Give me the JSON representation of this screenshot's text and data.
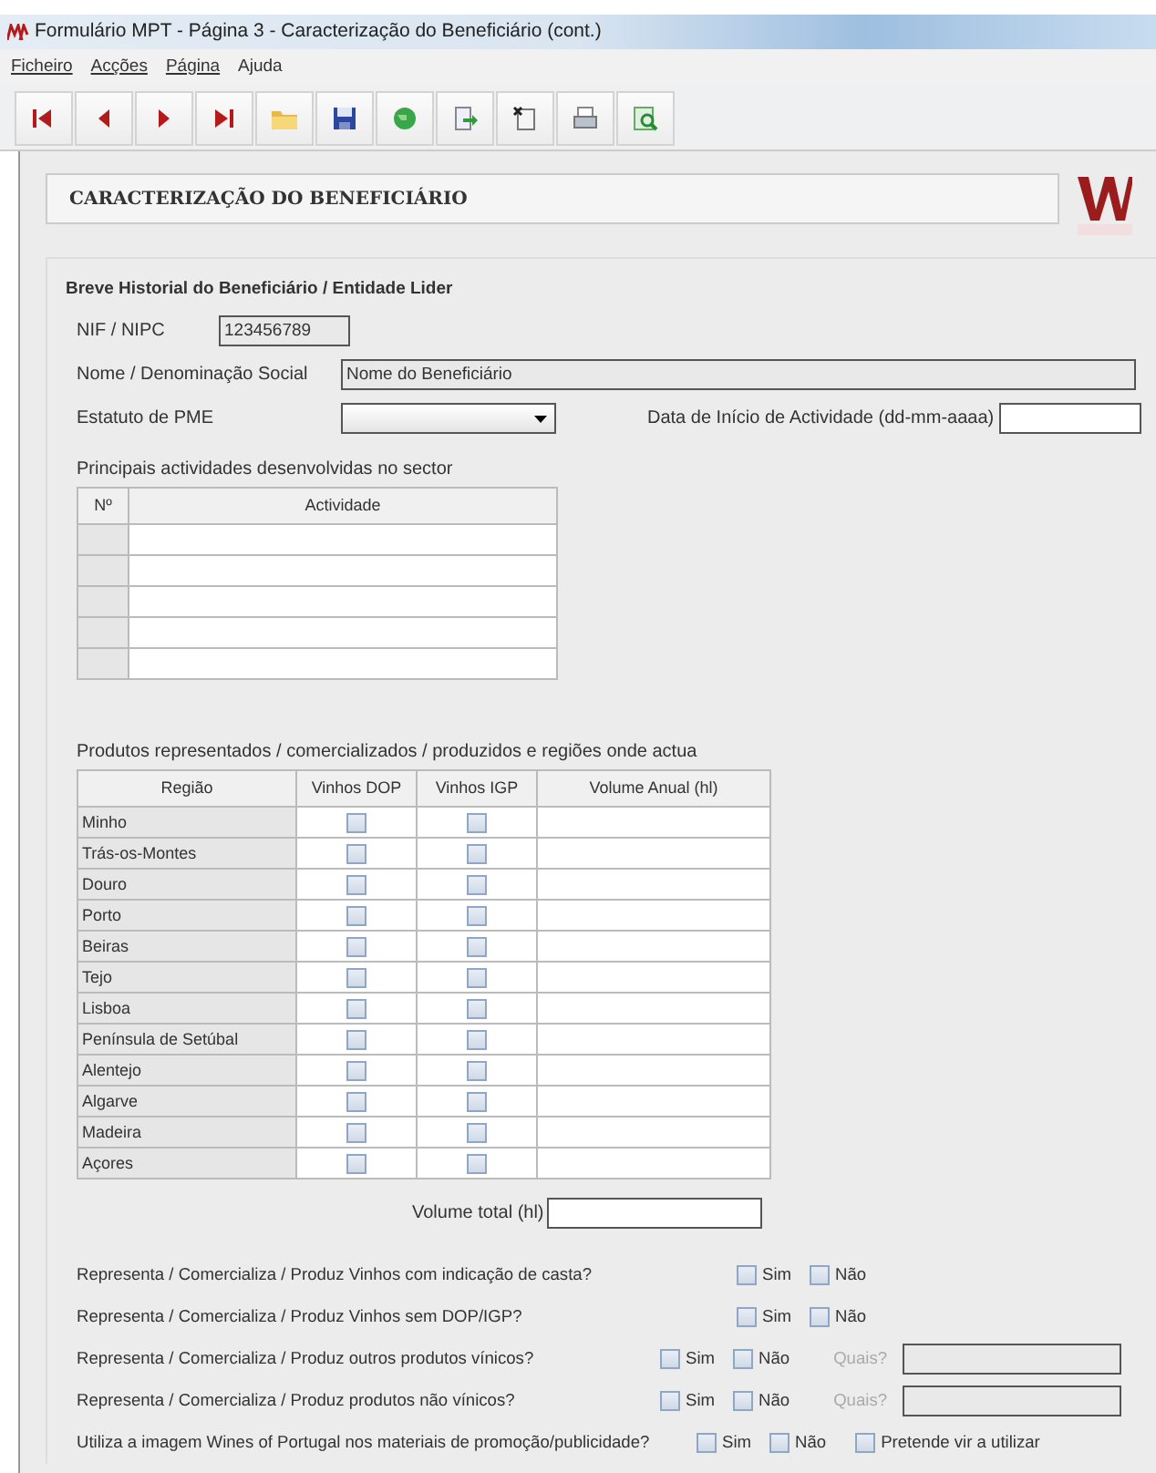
{
  "window": {
    "title": "Formulário MPT - Página 3 - Caracterização do Beneficiário (cont.)"
  },
  "menu": [
    {
      "label": "Ficheiro",
      "mnemonic_underlined": true
    },
    {
      "label": "Acções",
      "mnemonic_underlined": true
    },
    {
      "label": "Página",
      "mnemonic_underlined": true
    },
    {
      "label": "Ajuda",
      "mnemonic_underlined": false
    }
  ],
  "toolbar": [
    {
      "kind": "first"
    },
    {
      "kind": "prev"
    },
    {
      "kind": "next"
    },
    {
      "kind": "last"
    },
    {
      "kind": "folder"
    },
    {
      "kind": "save"
    },
    {
      "kind": "globe"
    },
    {
      "kind": "export"
    },
    {
      "kind": "delete"
    },
    {
      "kind": "print"
    },
    {
      "kind": "find"
    }
  ],
  "header": {
    "title": "CARACTERIZAÇÃO DO BENEFICIÁRIO"
  },
  "section": {
    "title": "Breve Historial do Beneficiário / Entidade Lider",
    "nif": {
      "label": "NIF / NIPC",
      "value": "123456789"
    },
    "nome": {
      "label": "Nome / Denominação Social",
      "value": "Nome do Beneficiário"
    },
    "estatuto": {
      "label": "Estatuto de PME"
    },
    "data_inicio": {
      "label": "Data de Início de Actividade (dd-mm-aaaa)"
    },
    "activities": {
      "label": "Principais actividades desenvolvidas no sector",
      "columns": [
        "Nº",
        "Actividade"
      ]
    },
    "products": {
      "label": "Produtos representados / comercializados / produzidos e regiões onde actua",
      "columns": [
        "Região",
        "Vinhos DOP",
        "Vinhos IGP",
        "Volume Anual (hl)"
      ],
      "rows": [
        {
          "region": "Minho",
          "dop": false,
          "igp": false
        },
        {
          "region": "Trás-os-Montes",
          "dop": false,
          "igp": false
        },
        {
          "region": "Douro",
          "dop": false,
          "igp": false
        },
        {
          "region": "Porto",
          "dop": false,
          "igp": false
        },
        {
          "region": "Beiras",
          "dop": false,
          "igp": false
        },
        {
          "region": "Tejo",
          "dop": false,
          "igp": false
        },
        {
          "region": "Lisboa",
          "dop": false,
          "igp": false
        },
        {
          "region": "Península de Setúbal",
          "dop": false,
          "igp": false
        },
        {
          "region": "Alentejo",
          "dop": false,
          "igp": false
        },
        {
          "region": "Algarve",
          "dop": false,
          "igp": false
        },
        {
          "region": "Madeira",
          "dop": false,
          "igp": false
        },
        {
          "region": "Açores",
          "dop": false,
          "igp": false
        }
      ]
    },
    "volume_total": {
      "label": "Volume total (hl)"
    },
    "questions": [
      {
        "text": "Representa / Comercializa / Produz Vinhos com indicação de casta?",
        "options": [
          {
            "label": "Sim",
            "checked": false
          },
          {
            "label": "Não",
            "checked": false
          }
        ]
      },
      {
        "text": "Representa / Comercializa / Produz Vinhos sem DOP/IGP?",
        "options": [
          {
            "label": "Sim",
            "checked": false
          },
          {
            "label": "Não",
            "checked": false
          }
        ]
      },
      {
        "text": "Representa / Comercializa / Produz outros produtos vínicos?",
        "options": [
          {
            "label": "Sim",
            "checked": false
          },
          {
            "label": "Não",
            "checked": false
          }
        ],
        "which": {
          "label": "Quais?",
          "disabled": true
        }
      },
      {
        "text": "Representa / Comercializa / Produz produtos não vínicos?",
        "options": [
          {
            "label": "Sim",
            "checked": false
          },
          {
            "label": "Não",
            "checked": false
          }
        ],
        "which": {
          "label": "Quais?",
          "disabled": true
        }
      },
      {
        "text": "Utiliza a imagem Wines of Portugal nos materiais de promoção/publicidade?",
        "options": [
          {
            "label": "Sim",
            "checked": false
          },
          {
            "label": "Não",
            "checked": false
          },
          {
            "label": "Pretende vir a utilizar",
            "checked": false
          }
        ]
      }
    ]
  }
}
